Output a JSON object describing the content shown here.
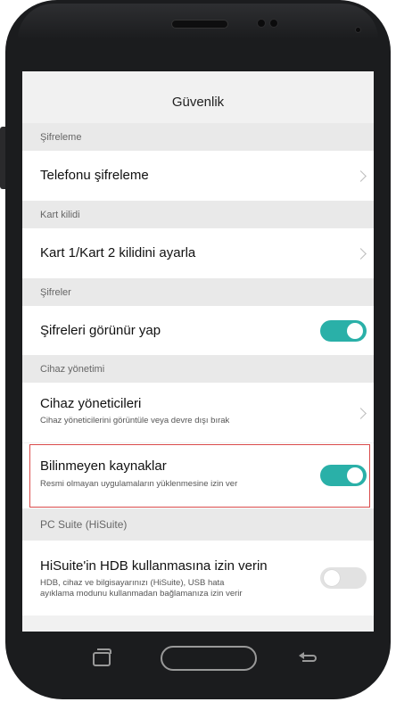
{
  "status_bar": {
    "text": ""
  },
  "header": {
    "title": "Güvenlik"
  },
  "sections": {
    "encryption": "Şifreleme",
    "card_lock": "Kart kilidi",
    "passwords": "Şifreler",
    "device_admin": "Cihaz yönetimi",
    "pc_suite": "PC Suite (HiSuite)"
  },
  "rows": {
    "phone_encrypt": {
      "title": "Telefonu şifreleme"
    },
    "card_lock": {
      "title": "Kart 1/Kart 2 kilidini ayarla"
    },
    "show_passwords": {
      "title": "Şifreleri görünür yap",
      "toggle": "on"
    },
    "device_admins": {
      "title": "Cihaz yöneticileri",
      "subtitle": "Cihaz yöneticilerini görüntüle veya devre dışı bırak"
    },
    "unknown_sources": {
      "title": "Bilinmeyen kaynaklar",
      "subtitle": "Resmi olmayan uygulamaların yüklenmesine izin ver",
      "toggle": "on"
    },
    "hisuite_hdb": {
      "title": "HiSuite'in HDB kullanmasına izin verin",
      "subtitle_line1": "HDB, cihaz ve bilgisayarınızı (HiSuite), USB hata",
      "subtitle_line2": "ayıklama modunu kullanmadan bağlamanıza izin verir",
      "toggle": "off"
    }
  },
  "colors": {
    "toggle_on": "#2ab0a8",
    "highlight": "#d94b4b"
  },
  "nav": {
    "recent_icon": "recent-apps-icon",
    "home_icon": "home-button",
    "back_icon": "back-icon"
  }
}
